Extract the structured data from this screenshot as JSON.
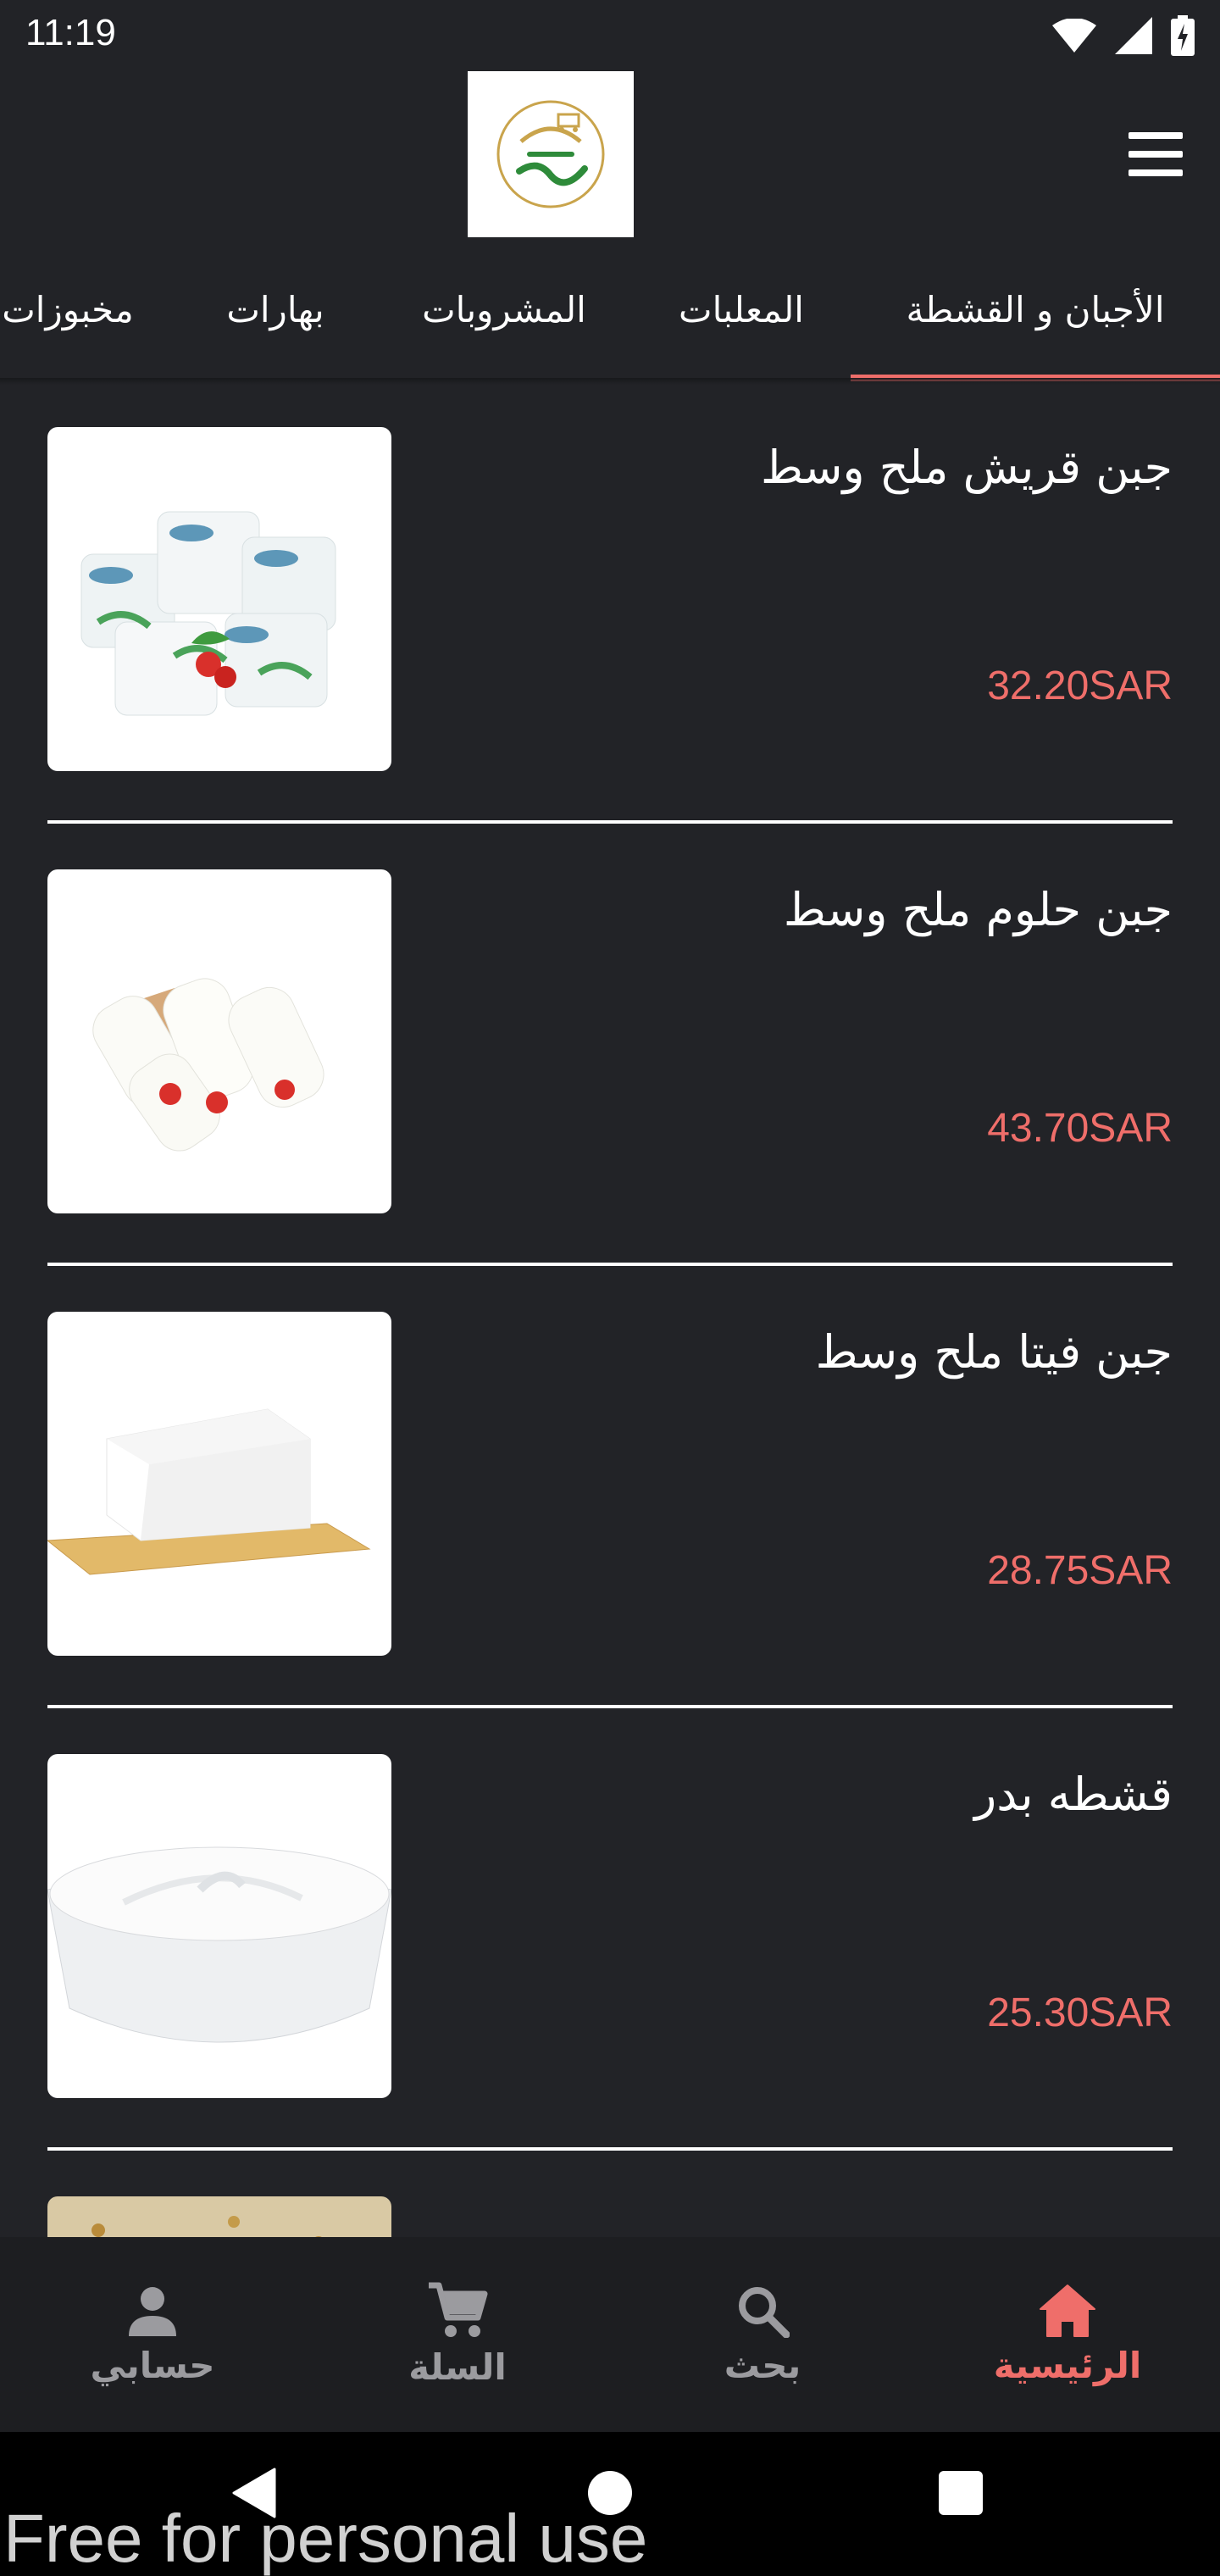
{
  "status_bar": {
    "time": "11:19",
    "icons": [
      "wifi-icon",
      "signal-icon",
      "battery-charging-icon"
    ]
  },
  "app_bar": {
    "logo_alt": "logo",
    "menu_icon": "hamburger-menu-icon"
  },
  "tabs": [
    {
      "label": "الأجبان و القشطة",
      "active": true
    },
    {
      "label": "المعلبات",
      "active": false
    },
    {
      "label": "المشروبات",
      "active": false
    },
    {
      "label": "بهارات",
      "active": false
    },
    {
      "label": "مخبوزات",
      "active": false
    }
  ],
  "products": [
    {
      "name": "جبن قريش ملح وسط",
      "price": "32.20SAR",
      "image": "cheese-cubes-image"
    },
    {
      "name": "جبن حلوم ملح وسط",
      "price": "43.70SAR",
      "image": "halloumi-image"
    },
    {
      "name": "جبن فيتا ملح وسط",
      "price": "28.75SAR",
      "image": "feta-image"
    },
    {
      "name": "قشطه بدر",
      "price": "25.30SAR",
      "image": "cream-bowl-image"
    },
    {
      "name": "",
      "price": "",
      "image": "partial-product-image"
    }
  ],
  "bottom_nav": [
    {
      "label": "حسابي",
      "icon": "person-icon",
      "active": false
    },
    {
      "label": "السلة",
      "icon": "cart-icon",
      "active": false
    },
    {
      "label": "بحث",
      "icon": "search-icon",
      "active": false
    },
    {
      "label": "الرئيسية",
      "icon": "home-icon",
      "active": true
    }
  ],
  "watermark": "Free for personal use",
  "colors": {
    "background": "#222327",
    "accent": "#ef6e6a",
    "nav_inactive": "#9b9b9f",
    "nav_background": "#1d1e21"
  }
}
